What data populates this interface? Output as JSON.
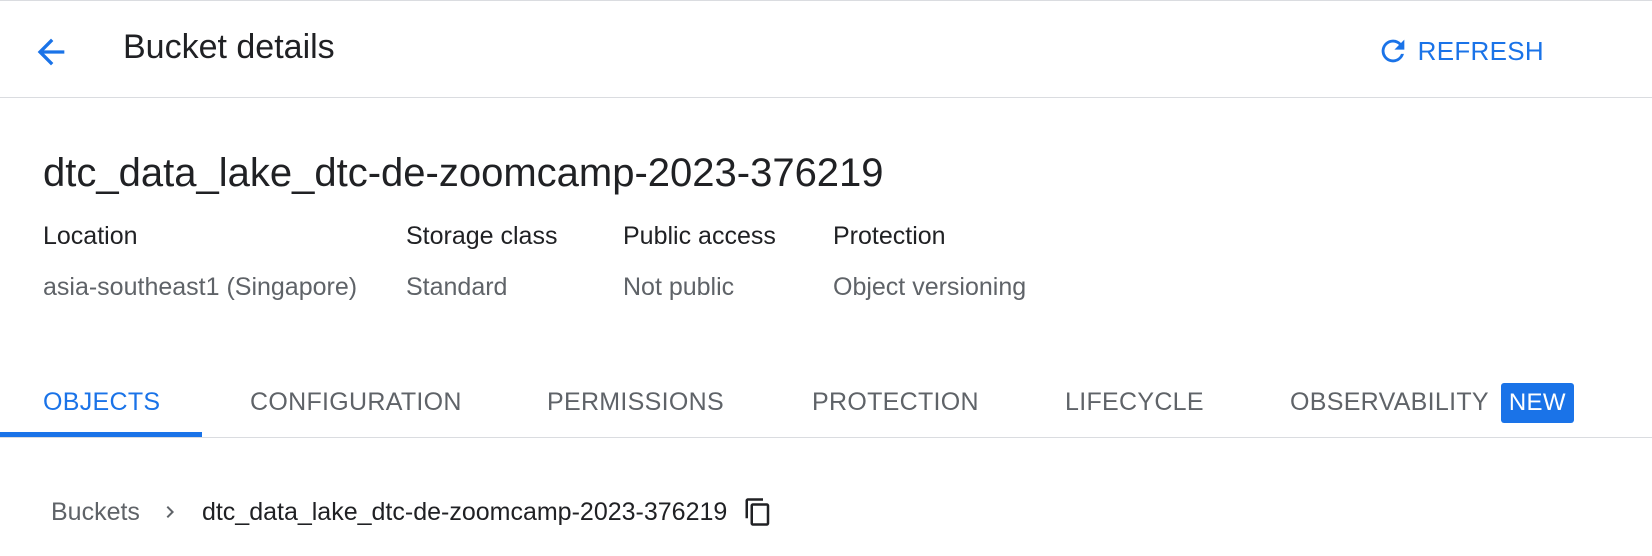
{
  "header": {
    "title": "Bucket details",
    "refresh_label": "REFRESH"
  },
  "bucket": {
    "name": "dtc_data_lake_dtc-de-zoomcamp-2023-376219"
  },
  "properties": [
    {
      "label": "Location",
      "value": "asia-southeast1 (Singapore)"
    },
    {
      "label": "Storage class",
      "value": "Standard"
    },
    {
      "label": "Public access",
      "value": "Not public"
    },
    {
      "label": "Protection",
      "value": "Object versioning"
    }
  ],
  "tabs": [
    {
      "label": "OBJECTS",
      "active": true
    },
    {
      "label": "CONFIGURATION"
    },
    {
      "label": "PERMISSIONS"
    },
    {
      "label": "PROTECTION"
    },
    {
      "label": "LIFECYCLE"
    },
    {
      "label": "OBSERVABILITY",
      "badge": "NEW"
    }
  ],
  "breadcrumb": {
    "root": "Buckets",
    "current": "dtc_data_lake_dtc-de-zoomcamp-2023-376219"
  },
  "icons": {
    "back": "arrow-back-icon",
    "refresh": "refresh-icon",
    "separator": "chevron-right-icon",
    "copy": "copy-icon"
  },
  "colors": {
    "accent": "#1a73e8",
    "text": "#202124",
    "muted": "#5f6368",
    "divider": "#dadce0"
  }
}
